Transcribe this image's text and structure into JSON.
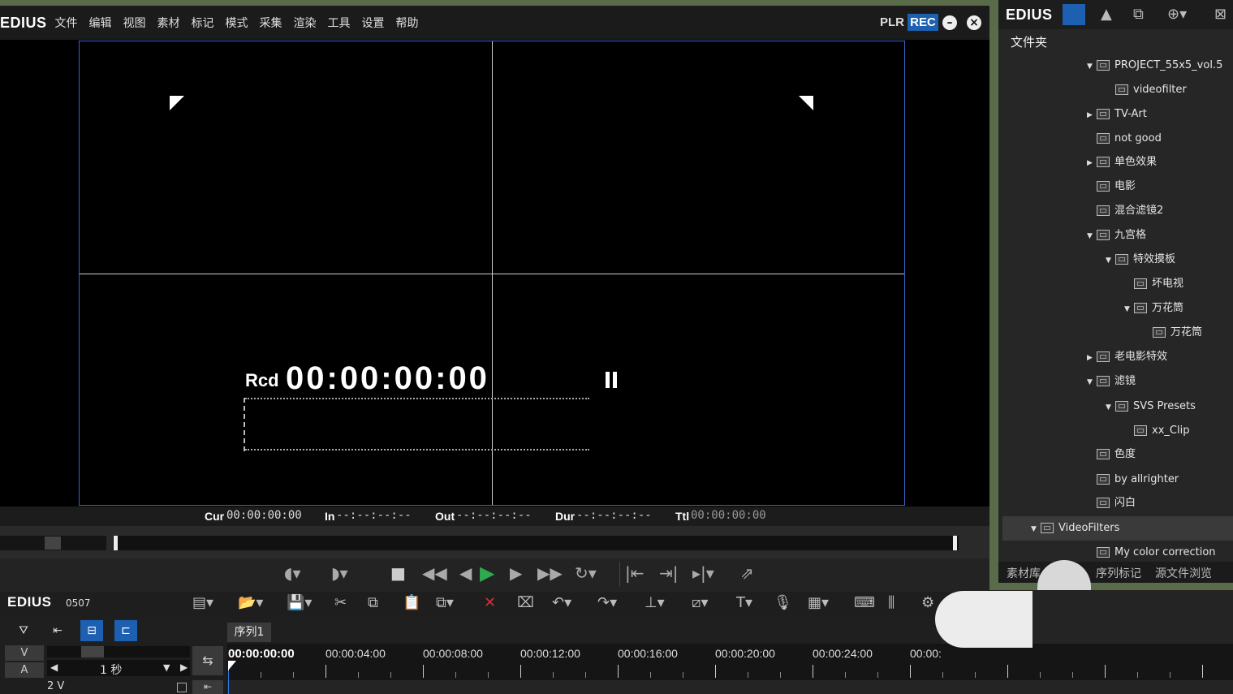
{
  "app": {
    "logo": "EDIUS"
  },
  "menu": [
    "文件",
    "编辑",
    "视图",
    "素材",
    "标记",
    "模式",
    "采集",
    "渲染",
    "工具",
    "设置",
    "帮助"
  ],
  "modes": {
    "plr": "PLR",
    "rec": "REC"
  },
  "monitor": {
    "rcd_label": "Rcd",
    "rcd_time": "00:00:00:00"
  },
  "timecodes": {
    "cur_label": "Cur",
    "cur_value": "00:00:00:00",
    "in_label": "In",
    "in_value": "--:--:--:--",
    "out_label": "Out",
    "out_value": "--:--:--:--",
    "dur_label": "Dur",
    "dur_value": "--:--:--:--",
    "ttl_label": "Ttl",
    "ttl_value": "00:00:00:00"
  },
  "bin": {
    "logo": "EDIUS",
    "title": "文件夹",
    "tree": [
      {
        "label": "PROJECT_55x5_vol.5",
        "depth": 0,
        "arrow": "down"
      },
      {
        "label": "videofilter",
        "depth": 1,
        "arrow": ""
      },
      {
        "label": "TV-Art",
        "depth": 0,
        "arrow": "right"
      },
      {
        "label": "not  good",
        "depth": 0,
        "arrow": ""
      },
      {
        "label": "单色效果",
        "depth": 0,
        "arrow": "right"
      },
      {
        "label": "电影",
        "depth": 0,
        "arrow": ""
      },
      {
        "label": "混合滤镜2",
        "depth": 0,
        "arrow": ""
      },
      {
        "label": "九宫格",
        "depth": 0,
        "arrow": "down"
      },
      {
        "label": "特效摸板",
        "depth": 1,
        "arrow": "down"
      },
      {
        "label": "坏电视",
        "depth": 2,
        "arrow": ""
      },
      {
        "label": "万花筒",
        "depth": 2,
        "arrow": "down"
      },
      {
        "label": "万花筒",
        "depth": 3,
        "arrow": ""
      },
      {
        "label": "老电影特效",
        "depth": 0,
        "arrow": "right"
      },
      {
        "label": "滤镜",
        "depth": 0,
        "arrow": "down"
      },
      {
        "label": "SVS Presets",
        "depth": 1,
        "arrow": "down"
      },
      {
        "label": "xx_Clip",
        "depth": 2,
        "arrow": ""
      },
      {
        "label": "色度",
        "depth": 0,
        "arrow": ""
      },
      {
        "label": "by allrighter",
        "depth": 0,
        "arrow": ""
      },
      {
        "label": "闪白",
        "depth": 0,
        "arrow": ""
      },
      {
        "label": "VideoFilters",
        "depth": -1,
        "arrow": "down"
      },
      {
        "label": "My color correction",
        "depth": 0,
        "arrow": ""
      }
    ],
    "tabs": [
      "素材库",
      "序列标记",
      "源文件浏览"
    ]
  },
  "timeline": {
    "logo": "EDIUS",
    "project": "0507",
    "sequence_tab": "序列1",
    "v_label": "V",
    "a_label": "A",
    "zoom": "1 秒",
    "track_2v": "2 V",
    "ruler": [
      "00:00:00:00",
      "00:00:04:00",
      "00:00:08:00",
      "00:00:12:00",
      "00:00:16:00",
      "00:00:20:00",
      "00:00:24:00",
      "00:00:"
    ]
  },
  "colors": {
    "accent": "#1d5fb0",
    "frame": "#3666c8",
    "play": "#2fa84f"
  }
}
